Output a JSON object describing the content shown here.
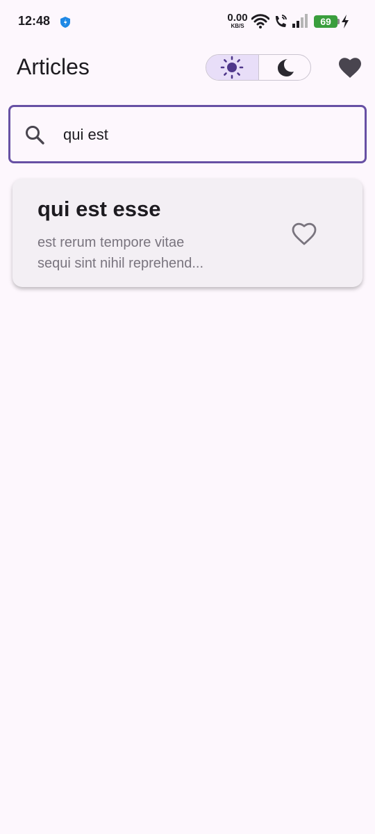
{
  "status_bar": {
    "time": "12:48",
    "net_speed_value": "0.00",
    "net_speed_unit": "KB/S",
    "battery_level": "69",
    "icons": [
      "shield-icon",
      "wifi-icon",
      "call-icon",
      "signal-icon",
      "battery-icon",
      "bolt-icon"
    ]
  },
  "app_bar": {
    "title": "Articles",
    "theme_toggle": {
      "options": [
        "light",
        "dark"
      ],
      "selected": "light",
      "icons": [
        "sun-icon",
        "moon-icon"
      ]
    },
    "favorites_icon": "heart-filled-icon"
  },
  "search": {
    "value": "qui est",
    "icon": "search-icon"
  },
  "articles": [
    {
      "title": "qui est esse",
      "body_line1": "est rerum tempore vitae",
      "body_line2": "sequi sint nihil reprehend...",
      "favorite_icon": "heart-outline-icon"
    }
  ],
  "colors": {
    "background": "#fdf7fd",
    "accent": "#6750a4",
    "selected_segment": "#e8def8",
    "card": "#f3eff4",
    "battery": "#3a9e3d"
  }
}
